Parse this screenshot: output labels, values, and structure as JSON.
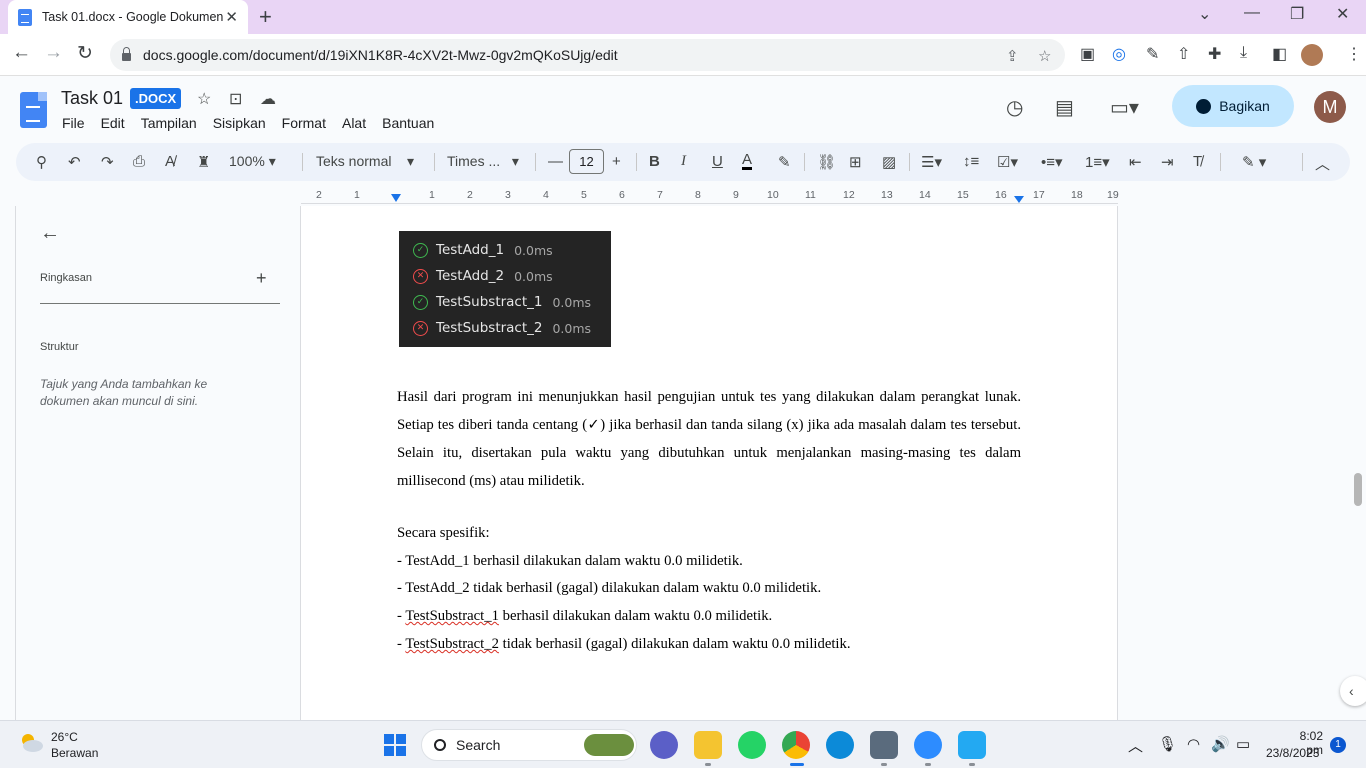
{
  "browser": {
    "tab_title": "Task 01.docx - Google Dokumen",
    "url": "docs.google.com/document/d/19iXN1K8R-4cXV2t-Mwz-0gv2mQKoSUjg/edit"
  },
  "doc": {
    "title": "Task 01",
    "badge": ".DOCX",
    "share_label": "Bagikan",
    "avatar_letter": "M"
  },
  "menu": [
    "File",
    "Edit",
    "Tampilan",
    "Sisipkan",
    "Format",
    "Alat",
    "Bantuan"
  ],
  "toolbar": {
    "zoom": "100%",
    "style": "Teks normal",
    "font": "Times ...",
    "font_size": "12"
  },
  "ruler": [
    "2",
    "1",
    "1",
    "2",
    "3",
    "4",
    "5",
    "6",
    "7",
    "8",
    "9",
    "10",
    "11",
    "12",
    "13",
    "14",
    "15",
    "16",
    "17",
    "18",
    "19"
  ],
  "sidebar": {
    "summary_label": "Ringkasan",
    "outline_label": "Struktur",
    "outline_empty": "Tajuk yang Anda tambahkan ke dokumen akan muncul di sini."
  },
  "test_results": [
    {
      "name": "TestAdd_1",
      "time": "0.0ms",
      "status": "pass"
    },
    {
      "name": "TestAdd_2",
      "time": "0.0ms",
      "status": "fail"
    },
    {
      "name": "TestSubstract_1",
      "time": "0.0ms",
      "status": "pass"
    },
    {
      "name": "TestSubstract_2",
      "time": "0.0ms",
      "status": "fail"
    }
  ],
  "body": {
    "paragraph": "Hasil dari program ini menunjukkan hasil pengujian untuk tes yang dilakukan dalam perangkat lunak. Setiap tes diberi tanda centang (✓) jika berhasil dan tanda silang (x) jika ada masalah dalam tes tersebut. Selain itu, disertakan pula waktu yang dibutuhkan untuk menjalankan masing-masing tes dalam millisecond (ms) atau milidetik.",
    "specific_heading": "Secara spesifik:",
    "line1": "- TestAdd_1 berhasil dilakukan dalam waktu 0.0 milidetik.",
    "line2": "- TestAdd_2 tidak berhasil (gagal) dilakukan dalam waktu 0.0 milidetik.",
    "line3_prefix": "- ",
    "line3_name": "TestSubstract_1",
    "line3_rest": " berhasil dilakukan dalam waktu 0.0 milidetik.",
    "line4_prefix": "- ",
    "line4_name": "TestSubstract_2",
    "line4_rest": " tidak berhasil (gagal) dilakukan dalam waktu 0.0 milidetik."
  },
  "taskbar": {
    "temp": "26°C",
    "weather": "Berawan",
    "search_label": "Search",
    "time": "8:02 pm",
    "date": "23/8/2023",
    "notifications": "1"
  }
}
